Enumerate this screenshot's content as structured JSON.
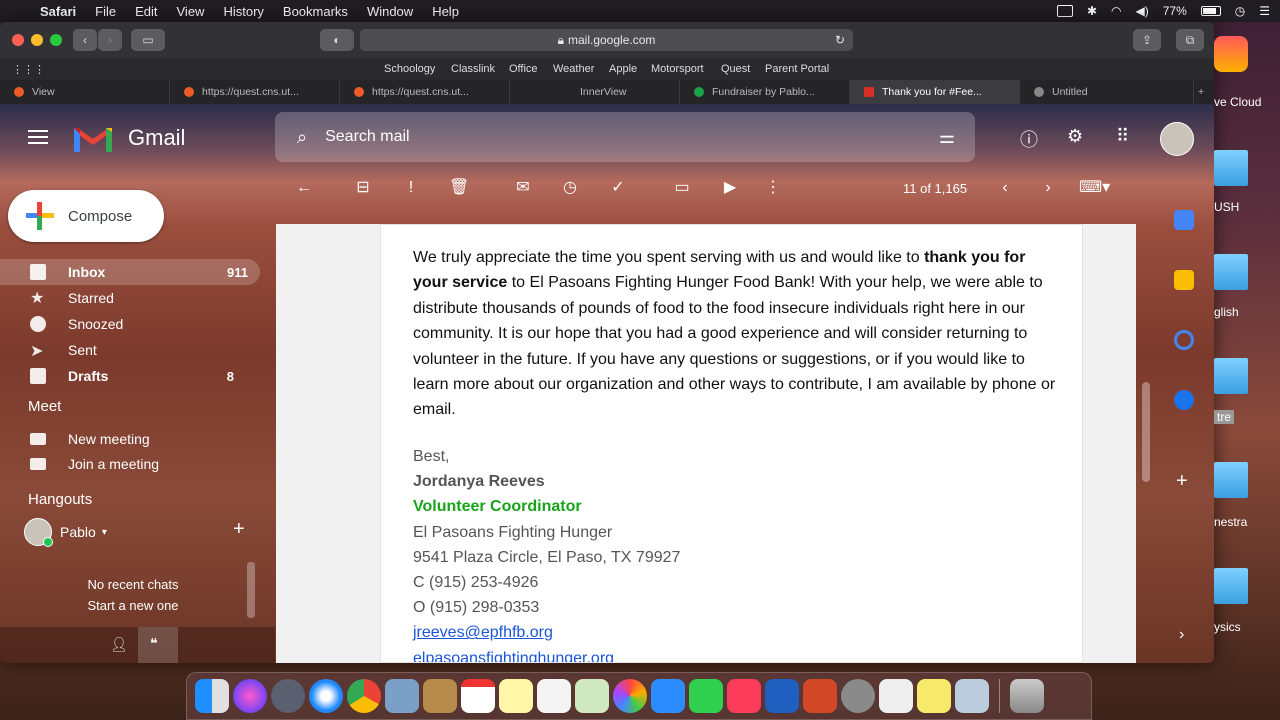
{
  "menubar": {
    "app": "Safari",
    "items": [
      "File",
      "Edit",
      "View",
      "History",
      "Bookmarks",
      "Window",
      "Help"
    ],
    "battery": "77%"
  },
  "browser": {
    "url": "mail.google.com",
    "favorites": [
      "Schoology",
      "Classlink",
      "Office",
      "Weather",
      "Apple",
      "Motorsport",
      "Quest",
      "Parent Portal"
    ],
    "tabs": [
      {
        "label": "View"
      },
      {
        "label": "https://quest.cns.ut..."
      },
      {
        "label": "https://quest.cns.ut..."
      },
      {
        "label": "InnerView"
      },
      {
        "label": "Fundraiser by Pablo..."
      },
      {
        "label": "Thank you for #Fee..."
      },
      {
        "label": "Untitled"
      }
    ]
  },
  "gmail": {
    "logo_text": "Gmail",
    "search_placeholder": "Search mail",
    "compose_label": "Compose",
    "nav": [
      {
        "label": "Inbox",
        "count": "911"
      },
      {
        "label": "Starred",
        "count": ""
      },
      {
        "label": "Snoozed",
        "count": ""
      },
      {
        "label": "Sent",
        "count": ""
      },
      {
        "label": "Drafts",
        "count": "8"
      }
    ],
    "meet_title": "Meet",
    "meet_items": [
      "New meeting",
      "Join a meeting"
    ],
    "hangouts_title": "Hangouts",
    "hangouts_user": "Pablo",
    "no_chats": "No recent chats",
    "start_chat": "Start a new one",
    "page_count": "11 of 1,165"
  },
  "message": {
    "p1": "We truly appreciate the time you spent serving with us and would like to ",
    "p1_bold": "thank you for your service",
    "p2": " to El Pasoans Fighting Hunger Food Bank! With your help, we were able to distribute thousands of pounds of food to the food insecure individuals right here in our community. It is our hope that you had a good experience and will consider returning to volunteer in the future. If you have any questions or suggestions, or if you would like to learn more about our organization and other ways to contribute, I am available by phone or email.",
    "closing": "Best,",
    "sender_name": "Jordanya Reeves",
    "sender_role": "Volunteer Coordinator",
    "org": "El Pasoans Fighting Hunger",
    "address": "9541 Plaza Circle, El Paso, TX 79927",
    "cell": "C (915) 253-4926",
    "office": "O (915) 298-0353",
    "email": "jreeves@epfhfb.org",
    "website": "elpasoansfightinghunger.org"
  },
  "desktop": {
    "labels": [
      "ve Cloud",
      "USH",
      "glish",
      "tre",
      "nestra",
      "ysics"
    ]
  },
  "colors": {
    "compose_plus": [
      "#ea4335",
      "#fbbc04",
      "#34a853",
      "#4285f4"
    ],
    "role_green": "#1aa31a",
    "link_blue": "#1a55d8"
  }
}
